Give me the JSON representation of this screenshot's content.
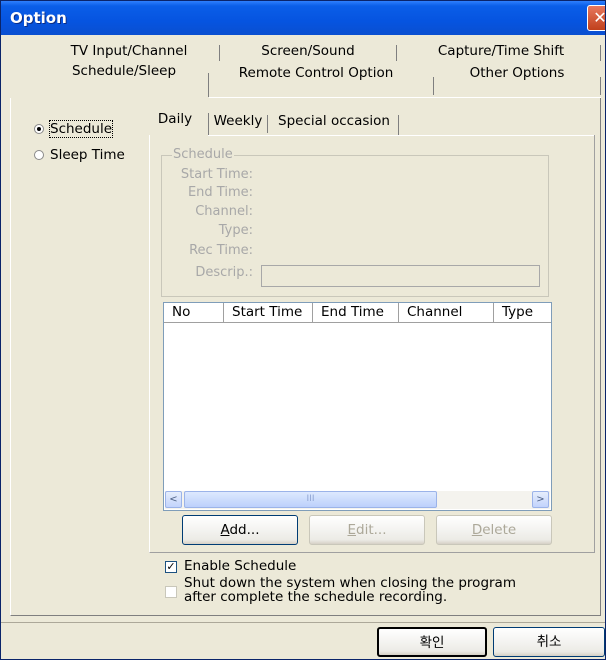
{
  "window": {
    "title": "Option",
    "close_symbol": "✕"
  },
  "tabs_row1": [
    "TV Input/Channel",
    "Screen/Sound",
    "Capture/Time Shift"
  ],
  "tabs_row2": [
    "Schedule/Sleep",
    "Remote Control Option",
    "Other Options"
  ],
  "mode_options": {
    "schedule": "Schedule",
    "sleep_time": "Sleep Time"
  },
  "subtabs": [
    "Daily",
    "Weekly",
    "Special occasion"
  ],
  "schedule_group": {
    "title": "Schedule",
    "fields": [
      "Start Time:",
      "End Time:",
      "Channel:",
      "Type:",
      "Rec Time:",
      "Descrip.:"
    ]
  },
  "table": {
    "columns": [
      "No",
      "Start Time",
      "End Time",
      "Channel",
      "Type"
    ],
    "rows": []
  },
  "scrollbar": {
    "left_arrow": "<",
    "right_arrow": ">",
    "thumb_grip": "III"
  },
  "buttons": {
    "add_mn": "A",
    "add_rest": "dd...",
    "edit_mn": "E",
    "edit_rest": "dit...",
    "delete_mn": "D",
    "delete_rest": "elete"
  },
  "options": {
    "enable_schedule": "Enable Schedule",
    "enable_schedule_checked": true,
    "shutdown_line1": "Shut down the system when closing the program",
    "shutdown_line2": "after complete the schedule recording.",
    "shutdown_checked": false,
    "check_mark": "✓"
  },
  "footer": {
    "ok": "확인",
    "cancel": "취소"
  }
}
